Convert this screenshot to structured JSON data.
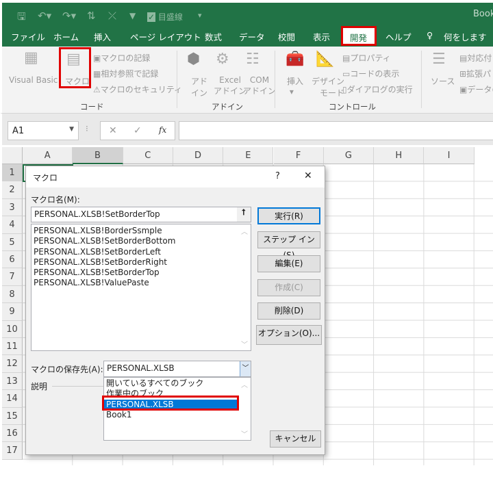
{
  "titlebar": {
    "title": "Book",
    "quick_access": {
      "save": "🖫",
      "undo": "↶▾",
      "redo": "↷▾",
      "sort": "⇅",
      "clear": "⤫",
      "filter": "▼",
      "gridlines_label": "目盛線",
      "customize": "▾"
    }
  },
  "tabs": [
    "ファイル",
    "ホーム",
    "挿入",
    "ページ レイアウト",
    "数式",
    "データ",
    "校閲",
    "表示",
    "開発",
    "ヘルプ"
  ],
  "active_tab": "開発",
  "tell_me": "何をしますか",
  "ribbon": {
    "code": {
      "label": "コード",
      "visual_basic": "Visual Basic",
      "macro": "マクロ",
      "record": "マクロの記録",
      "relative": "相対参照で記録",
      "security": "マクロのセキュリティ"
    },
    "addins": {
      "label": "アドイン",
      "addin": [
        "アド",
        "イン"
      ],
      "excel_addin": [
        "Excel",
        "アドイン"
      ],
      "com_addin": [
        "COM",
        "アドイン"
      ]
    },
    "controls": {
      "label": "コントロール",
      "insert": "挿入",
      "design": [
        "デザイン",
        "モード"
      ],
      "properties": "プロパティ",
      "view_code": "コードの表示",
      "run_dialog": "ダイアログの実行"
    },
    "xml": {
      "source": "ソース",
      "map": "対応付",
      "expansion": "拡張パ",
      "data": "データの"
    }
  },
  "formula_bar": {
    "name_box": "A1",
    "cancel": "✕",
    "enter": "✓",
    "fx": "fx",
    "value": ""
  },
  "columns": [
    "A",
    "B",
    "C",
    "D",
    "E",
    "F",
    "G",
    "H",
    "I"
  ],
  "rows": [
    "1",
    "2",
    "3",
    "4",
    "5",
    "6",
    "7",
    "8",
    "9",
    "10",
    "11",
    "12",
    "13",
    "14",
    "15",
    "16",
    "17"
  ],
  "dialog": {
    "title": "マクロ",
    "help": "?",
    "close": "✕",
    "name_label": "マクロ名(M):",
    "name_value": "PERSONAL.XLSB!SetBorderTop",
    "macros": [
      "PERSONAL.XLSB!BorderSsmple",
      "PERSONAL.XLSB!SetBorderBottom",
      "PERSONAL.XLSB!SetBorderLeft",
      "PERSONAL.XLSB!SetBorderRight",
      "PERSONAL.XLSB!SetBorderTop",
      "PERSONAL.XLSB!ValuePaste"
    ],
    "buttons": {
      "run": "実行(R)",
      "step_in": "ステップ イン(S)",
      "edit": "編集(E)",
      "create": "作成(C)",
      "delete": "削除(D)",
      "options": "オプション(O)...",
      "cancel": "キャンセル"
    },
    "location_label": "マクロの保存先(A):",
    "location_value": "PERSONAL.XLSB",
    "location_options": [
      "開いているすべてのブック",
      "作業中のブック",
      "PERSONAL.XLSB",
      "Book1"
    ],
    "location_selected": "PERSONAL.XLSB",
    "description_label": "説明"
  },
  "colors": {
    "excel_green": "#217346",
    "highlight": "#e00000",
    "selection": "#0078d7"
  }
}
